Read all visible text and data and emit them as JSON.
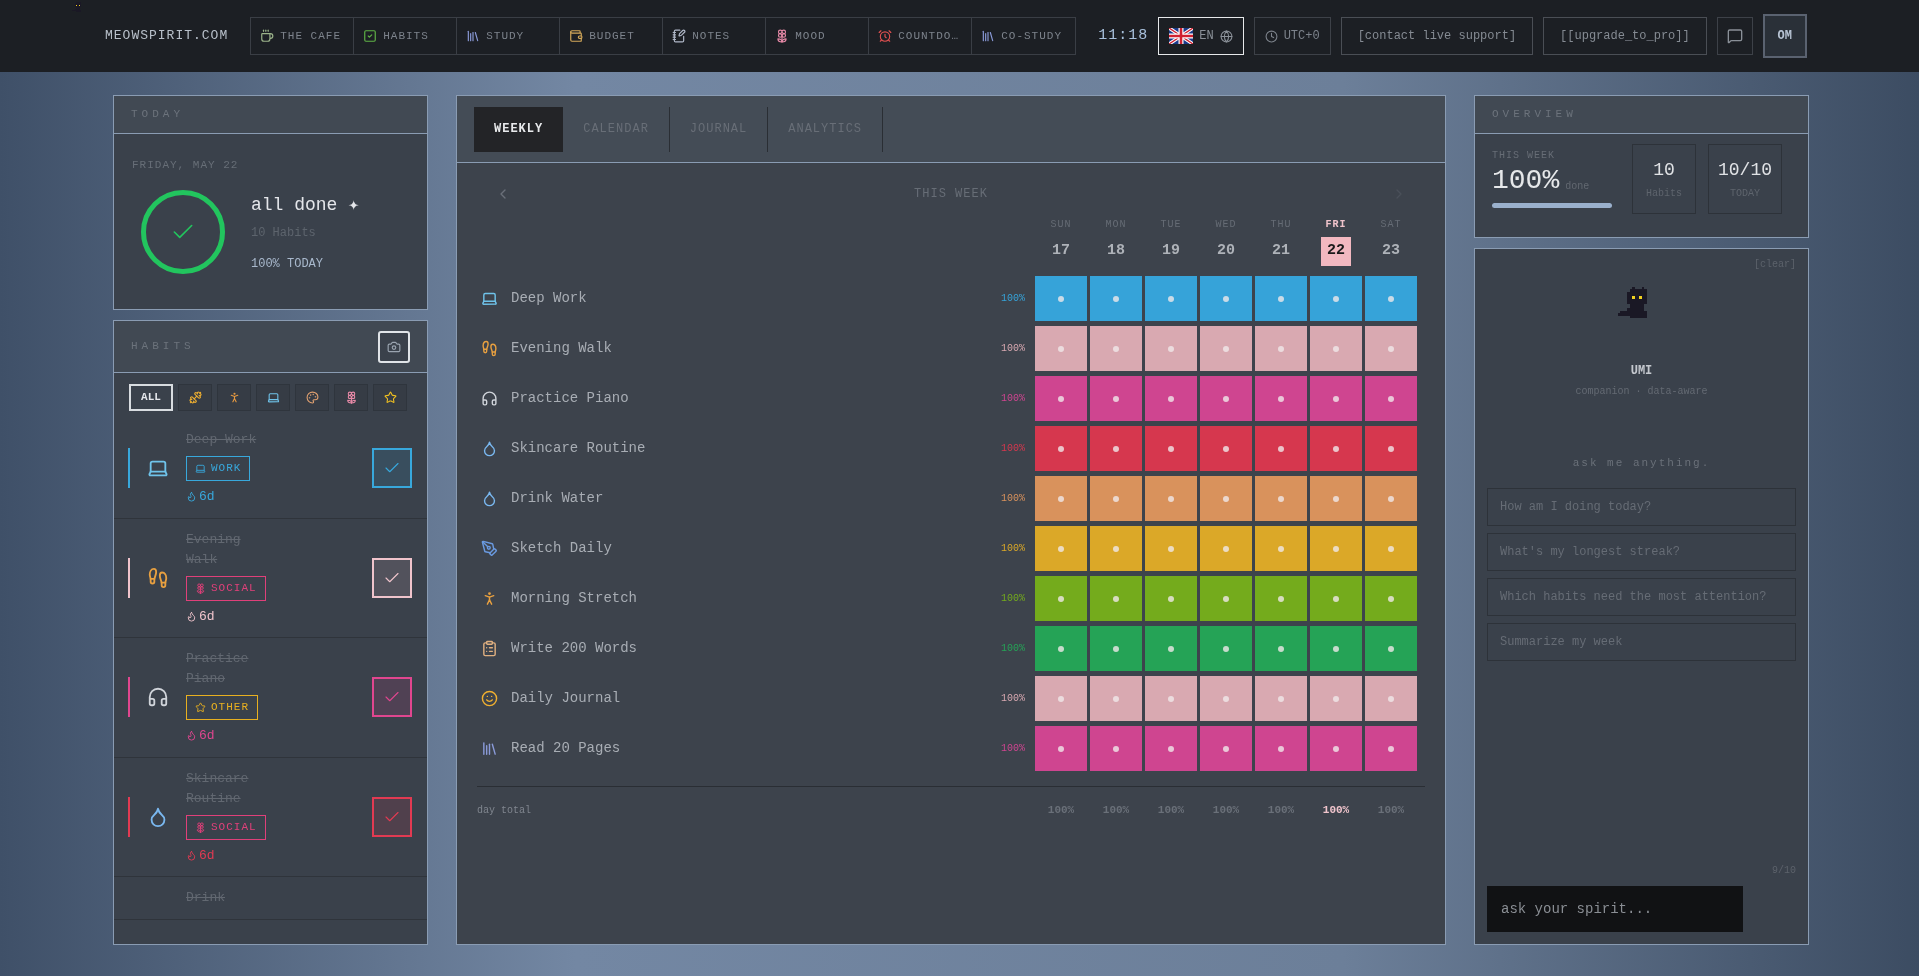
{
  "topbar": {
    "brand": "MEOWSPIRIT.COM",
    "nav": [
      {
        "label": "THE CAFE",
        "kind": "cup"
      },
      {
        "label": "HABITS",
        "kind": "check"
      },
      {
        "label": "STUDY",
        "kind": "books"
      },
      {
        "label": "BUDGET",
        "kind": "money"
      },
      {
        "label": "NOTES",
        "kind": "note"
      },
      {
        "label": "MOOD",
        "kind": "flower"
      },
      {
        "label": "COUNTDO…",
        "kind": "alarm"
      },
      {
        "label": "CO-STUDY",
        "kind": "books"
      }
    ],
    "time": "11:18",
    "language": "EN",
    "timezone": "UTC+0",
    "support": "[contact live support]",
    "upgrade": "[[upgrade_to_pro]]",
    "avatar": "OM"
  },
  "today": {
    "title": "TODAY",
    "date": "FRIDAY, MAY 22",
    "status": "all done ✦",
    "count": "10 Habits",
    "percent": "100% TODAY",
    "complete": true
  },
  "habits_panel": {
    "title": "HABITS",
    "filters": [
      {
        "kind": "text",
        "label": "ALL",
        "selected": true
      },
      {
        "kind": "muscle",
        "selected": false
      },
      {
        "kind": "person",
        "selected": false
      },
      {
        "kind": "laptop",
        "selected": false
      },
      {
        "kind": "palette",
        "selected": false
      },
      {
        "kind": "flower",
        "selected": false
      },
      {
        "kind": "star",
        "selected": false
      }
    ],
    "items": [
      {
        "name": "Deep Work",
        "kind": "laptop",
        "tag": {
          "label": "WORK",
          "kind": "laptop",
          "color": "#38a8dc"
        },
        "streak": "6d",
        "color": "#38a8dc",
        "done": true
      },
      {
        "name": "Evening Walk",
        "kind": "run",
        "tag": {
          "label": "SOCIAL",
          "kind": "flower",
          "color": "#e0407a"
        },
        "streak": "6d",
        "color": "#f0c4cc",
        "done": true
      },
      {
        "name": "Practice Piano",
        "kind": "headphones",
        "tag": {
          "label": "OTHER",
          "kind": "star",
          "color": "#e8b020"
        },
        "streak": "6d",
        "color": "#e0468f",
        "done": true
      },
      {
        "name": "Skincare Routine",
        "kind": "drop",
        "tag": {
          "label": "SOCIAL",
          "kind": "flower",
          "color": "#e0407a"
        },
        "streak": "6d",
        "color": "#e23a52",
        "done": true
      },
      {
        "name": "Drink",
        "done": true
      }
    ]
  },
  "main": {
    "tabs": [
      {
        "label": "WEEKLY",
        "selected": true
      },
      {
        "label": "CALENDAR",
        "selected": false
      },
      {
        "label": "JOURNAL",
        "selected": false
      },
      {
        "label": "ANALYTICS",
        "selected": false
      }
    ],
    "week_label": "THIS WEEK",
    "days": [
      {
        "name": "SUN",
        "date": "17",
        "total": "100%",
        "selected": false
      },
      {
        "name": "MON",
        "date": "18",
        "total": "100%",
        "selected": false
      },
      {
        "name": "TUE",
        "date": "19",
        "total": "100%",
        "selected": false
      },
      {
        "name": "WED",
        "date": "20",
        "total": "100%",
        "selected": false
      },
      {
        "name": "THU",
        "date": "21",
        "total": "100%",
        "selected": false
      },
      {
        "name": "FRI",
        "date": "22",
        "total": "100%",
        "selected": true
      },
      {
        "name": "SAT",
        "date": "23",
        "total": "100%",
        "selected": false
      }
    ],
    "rows": [
      {
        "name": "Deep Work",
        "kind": "laptop",
        "percent": "100%",
        "color": "#36a3d9",
        "checks": [
          true,
          true,
          true,
          true,
          true,
          true,
          true
        ]
      },
      {
        "name": "Evening Walk",
        "kind": "run",
        "percent": "100%",
        "color": "#d9a9b1",
        "checks": [
          true,
          true,
          true,
          true,
          true,
          true,
          true
        ]
      },
      {
        "name": "Practice Piano",
        "kind": "headphones",
        "percent": "100%",
        "color": "#cf4590",
        "checks": [
          true,
          true,
          true,
          true,
          true,
          true,
          true
        ]
      },
      {
        "name": "Skincare Routine",
        "kind": "drop",
        "percent": "100%",
        "color": "#d6374e",
        "checks": [
          true,
          true,
          true,
          true,
          true,
          true,
          true
        ]
      },
      {
        "name": "Drink Water",
        "kind": "drop",
        "percent": "100%",
        "color": "#d9925c",
        "checks": [
          true,
          true,
          true,
          true,
          true,
          true,
          true
        ]
      },
      {
        "name": "Sketch Daily",
        "kind": "pen",
        "percent": "100%",
        "color": "#dba828",
        "checks": [
          true,
          true,
          true,
          true,
          true,
          true,
          true
        ]
      },
      {
        "name": "Morning Stretch",
        "kind": "stretch",
        "percent": "100%",
        "color": "#74ab1c",
        "checks": [
          true,
          true,
          true,
          true,
          true,
          true,
          true
        ]
      },
      {
        "name": "Write 200 Words",
        "kind": "clipboard",
        "percent": "100%",
        "color": "#25a356",
        "checks": [
          true,
          true,
          true,
          true,
          true,
          true,
          true
        ]
      },
      {
        "name": "Daily Journal",
        "kind": "smile",
        "percent": "100%",
        "color": "#d9a9b1",
        "checks": [
          true,
          true,
          true,
          true,
          true,
          true,
          true
        ]
      },
      {
        "name": "Read 20 Pages",
        "kind": "books",
        "percent": "100%",
        "color": "#cf4590",
        "checks": [
          true,
          true,
          true,
          true,
          true,
          true,
          true
        ]
      }
    ],
    "total_label": "day total"
  },
  "overview": {
    "title": "OVERVIEW",
    "week_label": "THIS WEEK",
    "percent": "100%",
    "done_label": "done",
    "level": 1,
    "stats": [
      {
        "value": "10",
        "label": "Habits"
      },
      {
        "value": "10/10",
        "label": "TODAY"
      }
    ]
  },
  "chat": {
    "clear": "[clear]",
    "name": "UMI",
    "subtitle": "companion · data-aware",
    "prompt": "ask me anything.",
    "suggestions": [
      "How am I doing today?",
      "What's my longest streak?",
      "Which habits need the most attention?",
      "Summarize my week"
    ],
    "counter": "9/10",
    "placeholder": "ask your spirit..."
  }
}
